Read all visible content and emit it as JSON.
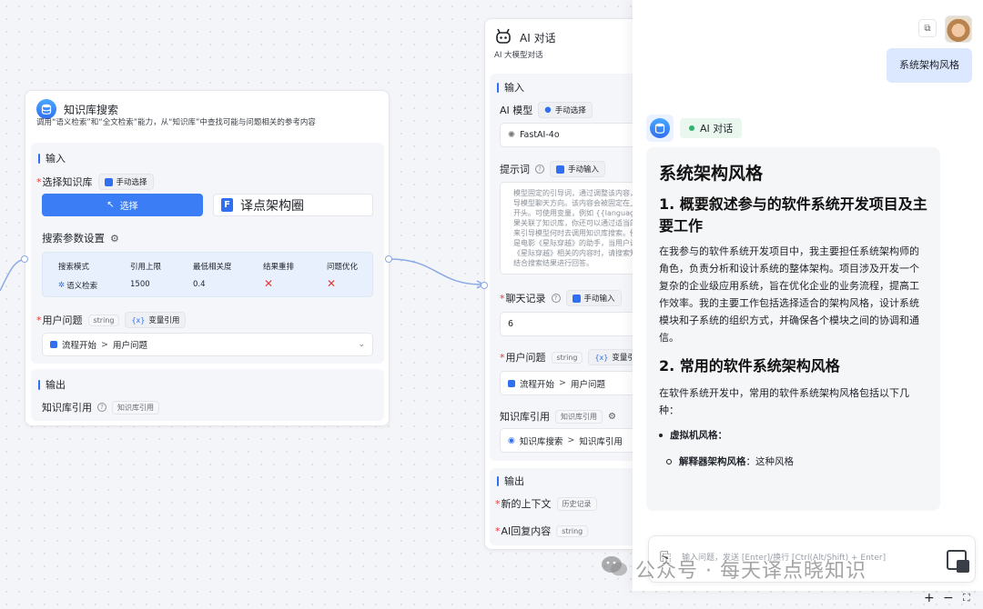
{
  "kb_node": {
    "title": "知识库搜索",
    "description": "调用“语义检索”和“全文检索”能力，从“知识库”中查找可能与问题相关的参考内容",
    "input_title": "输入",
    "select_kb_label": "选择知识库",
    "manual_select_chip": "手动选择",
    "select_button": "选择",
    "kb_name": "译点架构圈",
    "search_params_label": "搜索参数设置",
    "params_headers": [
      "搜索模式",
      "引用上限",
      "最低相关度",
      "结果重排",
      "问题优化"
    ],
    "params_values": {
      "mode": "语义检索",
      "limit": "1500",
      "min_rel": "0.4",
      "rerank": "✕",
      "optimize": "✕"
    },
    "user_question_label": "用户问题",
    "user_question_type": "string",
    "var_ref_chip": "变量引用",
    "user_question_source": "流程开始",
    "user_question_target": "用户问题",
    "output_title": "输出",
    "kb_ref_label": "知识库引用",
    "kb_ref_type": "知识库引用"
  },
  "ai_node": {
    "title": "AI 对话",
    "description": "AI 大模型对话",
    "input_title": "输入",
    "model_label": "AI 模型",
    "model_chip": "手动选择",
    "model_value": "FastAI-4o",
    "prompt_label": "提示词",
    "prompt_chip": "手动输入",
    "prompt_text": "模型固定的引导词，通过调整该内容，可以引导模型聊天方向。该内容会被固定在上下文的开头。可使用变量，例如 {{language}} 如果关联了知识库，你还可以通过适当的描述，来引导模型何时去调用知识库搜索。例如：你是电影《星际穿越》的助手，当用户询问与《星际穿越》相关的内容时，请搜索知识库并结合搜索结果进行回答。",
    "history_label": "聊天记录",
    "history_chip": "手动输入",
    "history_value": "6",
    "user_question_label": "用户问题",
    "user_question_type": "string",
    "var_ref_chip": "变量引用",
    "user_question_source": "流程开始",
    "user_question_target": "用户问题",
    "kb_ref_label": "知识库引用",
    "kb_ref_type": "知识库引用",
    "kb_ref_source": "知识库搜索",
    "kb_ref_target": "知识库引用",
    "output_title": "输出",
    "new_context_label": "新的上下文",
    "new_context_type": "历史记录",
    "ai_reply_label": "AI回复内容",
    "ai_reply_type": "string"
  },
  "chat": {
    "user_message": "系统架构风格",
    "assistant_tag": "AI 对话",
    "h1": "系统架构风格",
    "h2_1": "1. 概要叙述参与的软件系统开发项目及主要工作",
    "p1": "在我参与的软件系统开发项目中，我主要担任系统架构师的角色，负责分析和设计系统的整体架构。项目涉及开发一个复杂的企业级应用系统，旨在优化企业的业务流程，提高工作效率。我的主要工作包括选择适合的架构风格，设计系统模块和子系统的组织方式，并确保各个模块之间的协调和通信。",
    "h2_2": "2. 常用的软件系统架构风格",
    "p2": "在软件系统开发中，常用的软件系统架构风格包括以下几种：",
    "li1": "虚拟机风格：",
    "li2_bold": "解释器架构风格",
    "li2_rest": "：这种风格",
    "input_placeholder": "输入问题，发送 [Enter]/换行 [Ctrl(Alt/Shift) + Enter]"
  },
  "watermark": "公众号 · 每天译点晓知识",
  "zoom": {
    "plus": "+",
    "minus": "−"
  },
  "colors": {
    "accent": "#2f6ff0",
    "user_bubble": "#dbe8ff",
    "danger": "#e53935",
    "tag_green": "#2fb36e"
  },
  "icons": [
    "database-icon",
    "robot-icon",
    "gear-icon",
    "copy-icon",
    "avatar",
    "attach-icon",
    "send-icon",
    "fit-view-icon"
  ]
}
